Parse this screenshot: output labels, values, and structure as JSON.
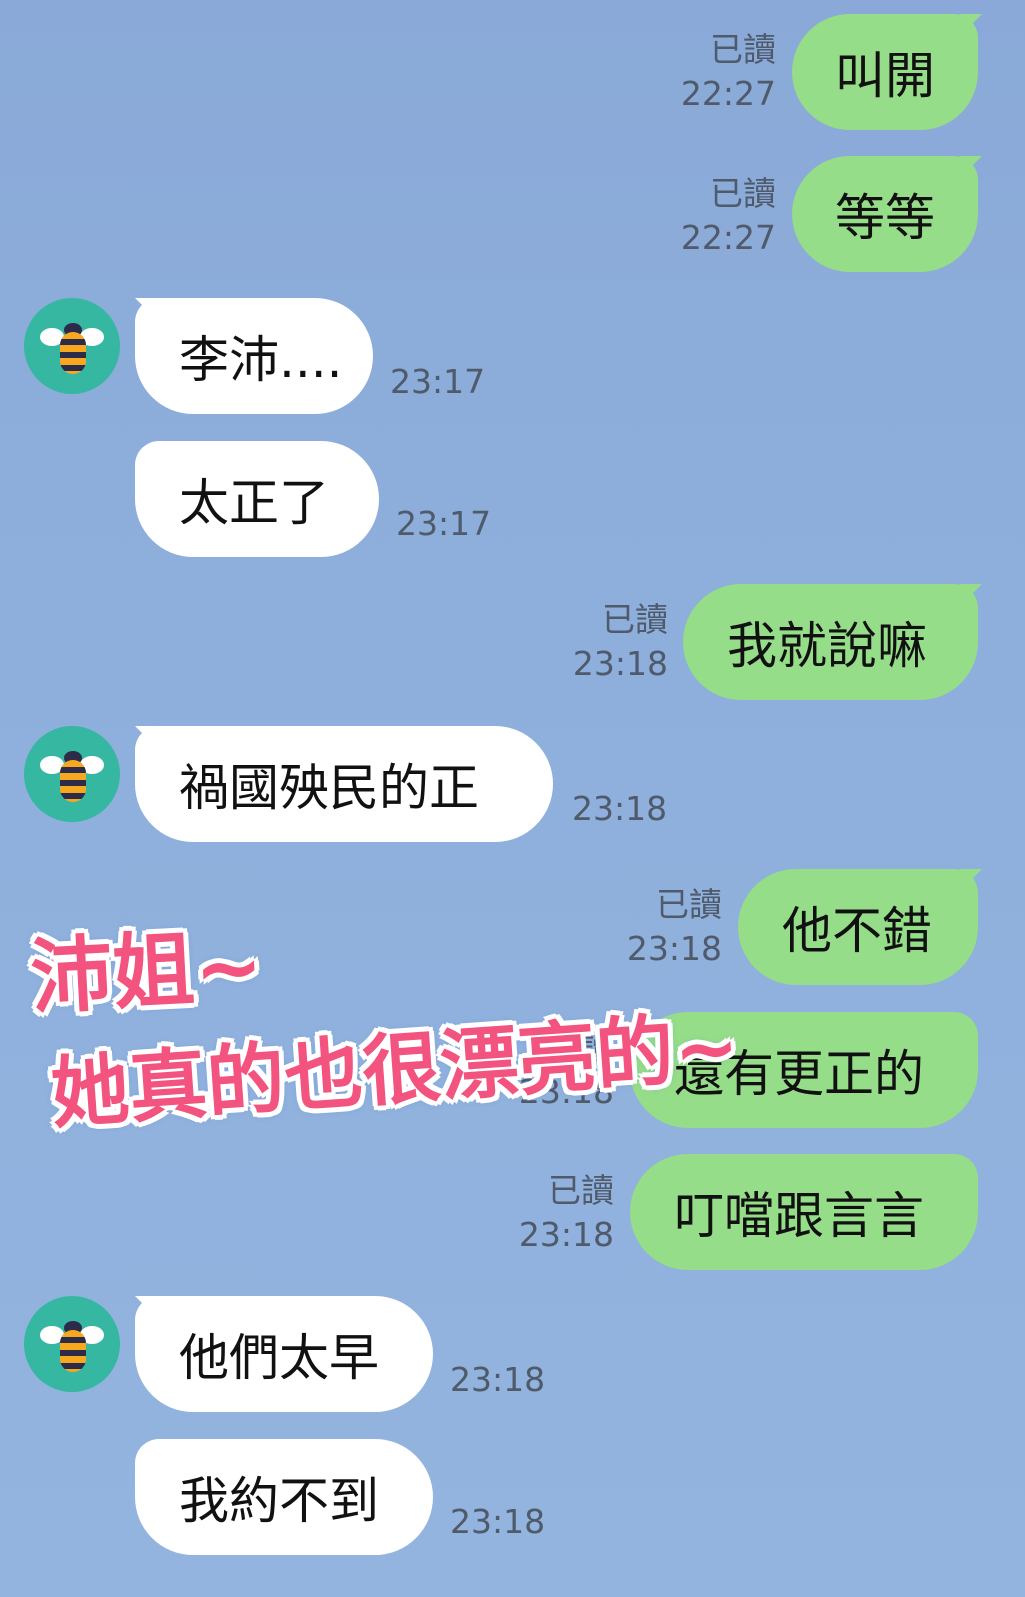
{
  "messages": {
    "m1": {
      "text": "叫開",
      "read": "已讀",
      "time": "22:27"
    },
    "m2": {
      "text": "等等",
      "read": "已讀",
      "time": "22:27"
    },
    "m3": {
      "text": "李沛....",
      "time": "23:17"
    },
    "m4": {
      "text": "太正了",
      "time": "23:17"
    },
    "m5": {
      "text": "我就說嘛",
      "read": "已讀",
      "time": "23:18"
    },
    "m6": {
      "text": "禍國殃民的正",
      "time": "23:18"
    },
    "m7": {
      "text": "他不錯",
      "read": "已讀",
      "time": "23:18"
    },
    "m8": {
      "text": "還有更正的",
      "read": "已讀",
      "time": "23:18"
    },
    "m9": {
      "text": "叮噹跟言言",
      "read": "已讀",
      "time": "23:18"
    },
    "m10": {
      "text": "他們太早",
      "time": "23:18"
    },
    "m11": {
      "text": "我約不到",
      "time": "23:18"
    }
  },
  "overlay": {
    "line1": "沛姐~",
    "line2": "她真的也很漂亮的~"
  },
  "avatar": {
    "icon": "bee-icon"
  },
  "colors": {
    "background": "#8fb0dc",
    "incoming_bubble": "#ffffff",
    "outgoing_bubble": "#95dd88",
    "overlay_text": "#f2537f"
  }
}
